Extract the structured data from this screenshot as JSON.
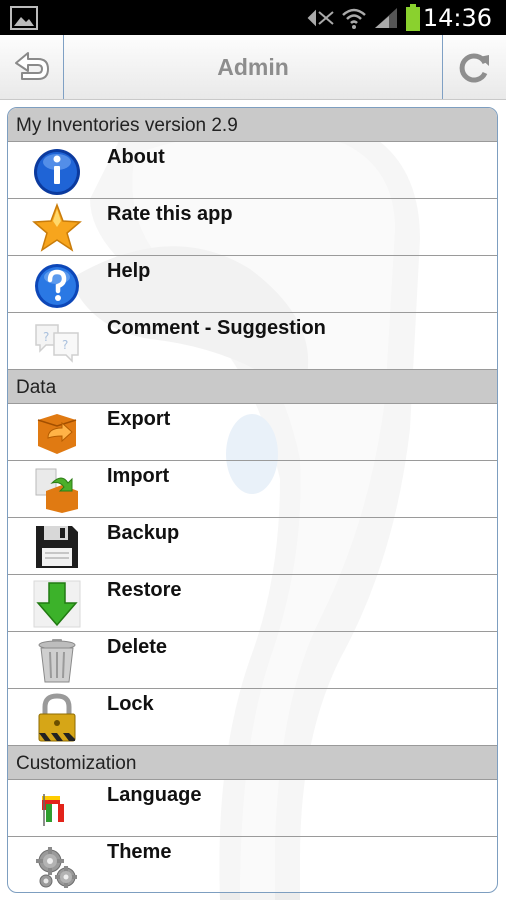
{
  "status_bar": {
    "time": "14:36"
  },
  "action_bar": {
    "title": "Admin"
  },
  "sections": [
    {
      "header": "My Inventories version 2.9",
      "items": [
        {
          "label": "About",
          "icon": "info-icon"
        },
        {
          "label": "Rate this app",
          "icon": "star-icon"
        },
        {
          "label": "Help",
          "icon": "help-icon"
        },
        {
          "label": "Comment - Suggestion",
          "icon": "comment-icon"
        }
      ]
    },
    {
      "header": "Data",
      "items": [
        {
          "label": "Export",
          "icon": "export-box-icon"
        },
        {
          "label": "Import",
          "icon": "import-box-icon"
        },
        {
          "label": "Backup",
          "icon": "floppy-disk-icon"
        },
        {
          "label": "Restore",
          "icon": "down-arrow-icon"
        },
        {
          "label": "Delete",
          "icon": "trash-can-icon"
        },
        {
          "label": "Lock",
          "icon": "padlock-icon"
        }
      ]
    },
    {
      "header": "Customization",
      "items": [
        {
          "label": "Language",
          "icon": "flags-icon"
        },
        {
          "label": "Theme",
          "icon": "gears-icon"
        }
      ]
    }
  ],
  "colors": {
    "panel_border": "#7d9ec0",
    "section_header_bg": "#c9c9c9",
    "title_gray": "#8d8d8d"
  }
}
